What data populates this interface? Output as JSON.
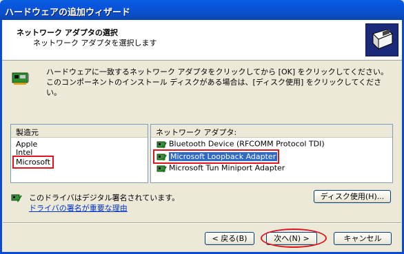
{
  "window": {
    "title": "ハードウェアの追加ウィザード"
  },
  "header": {
    "title": "ネットワーク アダプタの選択",
    "subtitle": "ネットワーク アダプタを選択します",
    "icon": "hardware-wizard-icon"
  },
  "instructions": "ハードウェアに一致するネットワーク アダプタをクリックしてから [OK] をクリックしてください。このコンポーネントのインストール ディスクがある場合は、[ディスク使用] をクリックしてください。",
  "manufacturers": {
    "header": "製造元",
    "items": [
      "Apple",
      "Intel",
      "Microsoft"
    ],
    "selected": "Microsoft"
  },
  "adapters": {
    "header": "ネットワーク アダプタ:",
    "items": [
      "Bluetooth Device (RFCOMM Protocol TDI)",
      "Microsoft Loopback Adapter",
      "Microsoft Tun Miniport Adapter"
    ],
    "selected": "Microsoft Loopback Adapter"
  },
  "signature": {
    "text": "このドライバはデジタル署名されています。",
    "link": "ドライバの署名が重要な理由"
  },
  "buttons": {
    "disk": "ディスク使用(H)...",
    "back": "< 戻る(B)",
    "next": "次へ(N) >",
    "cancel": "キャンセル"
  },
  "colors": {
    "titlebar": "#0a5fe0",
    "selection": "#316ac5",
    "highlight_annotation": "#e0141e",
    "dialog_bg": "#ece9d8"
  }
}
